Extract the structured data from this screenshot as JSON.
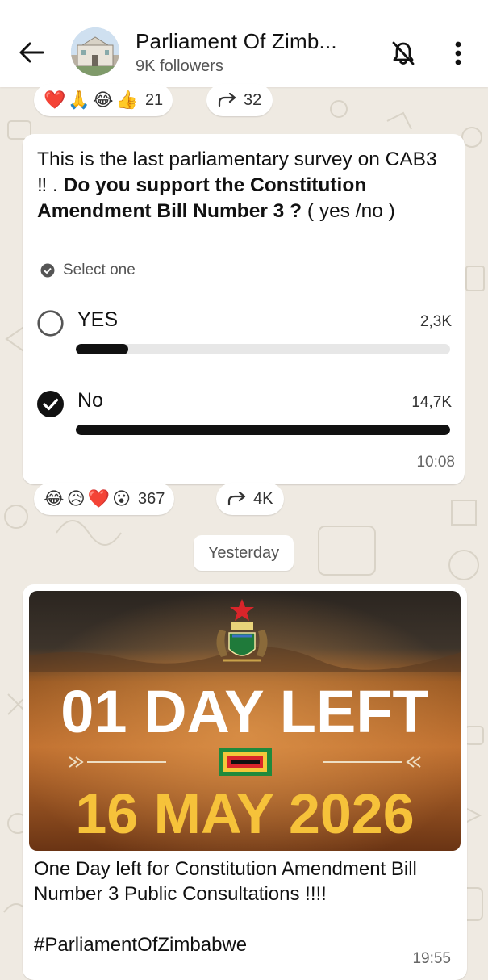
{
  "header": {
    "channel_name": "Parliament Of Zimb...",
    "followers": "9K followers",
    "icons": [
      "back-arrow-icon",
      "channel-avatar",
      "bell-off-icon",
      "more-vert-icon"
    ]
  },
  "top_reactions": {
    "emojis": [
      "❤️",
      "🙏",
      "😂",
      "👍"
    ],
    "count": "21",
    "forwards": "32"
  },
  "poll": {
    "question_part1": "This is the last parliamentary survey on CAB3 ‼ . ",
    "question_part2": "Do you support the Constitution Amendment Bill Number 3 ?",
    "question_part3": " ( yes /no )",
    "hint": "Select one",
    "options": [
      {
        "label": "YES",
        "count": "2,3K",
        "selected": false,
        "fill": 0.14
      },
      {
        "label": "No",
        "count": "14,7K",
        "selected": true,
        "fill": 1.0
      }
    ],
    "time": "10:08",
    "reactions": {
      "emojis": [
        "😂",
        "😥",
        "❤️",
        "😮"
      ],
      "count": "367",
      "forwards": "4K"
    }
  },
  "date_divider": "Yesterday",
  "post": {
    "banner_line1": "01 DAY LEFT",
    "banner_line2": "16 MAY 2026",
    "caption": "One Day left for Constitution Amendment Bill Number 3 Public Consultations !!!!",
    "hashtag": "#ParliamentOfZimbabwe",
    "time": "19:55"
  },
  "colors": {
    "wallpaper": "#efeae2",
    "bubble": "#ffffff",
    "bar_fill": "#111111",
    "bar_track": "#e7e7e7",
    "banner_text_white": "#ffffff",
    "banner_text_yellow": "#f6c23a"
  }
}
